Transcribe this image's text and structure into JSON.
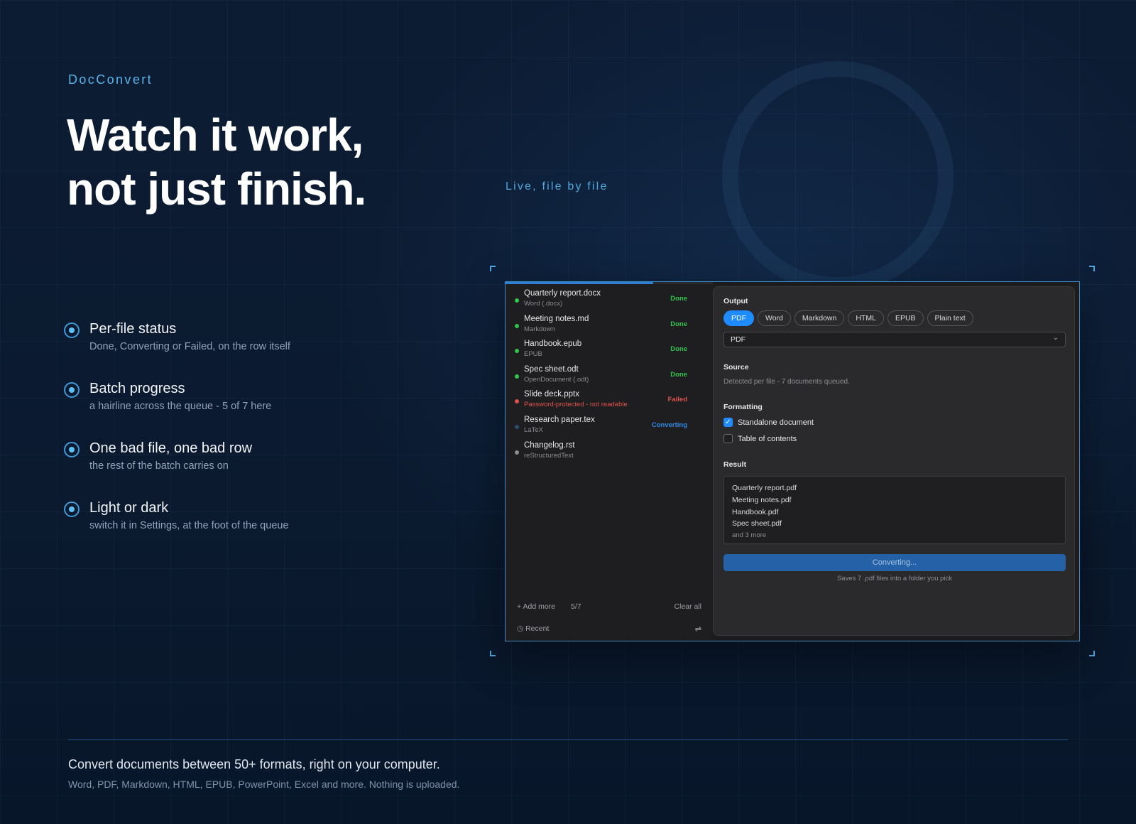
{
  "brand": "DocConvert",
  "headline": {
    "line1": "Watch it work,",
    "line2": "not just finish."
  },
  "kicker": "Live, file by file",
  "features": [
    {
      "title": "Per-file status",
      "desc": "Done, Converting or Failed, on the row itself"
    },
    {
      "title": "Batch progress",
      "desc": "a hairline across the queue - 5 of 7 here"
    },
    {
      "title": "One bad file, one bad row",
      "desc": "the rest of the batch carries on"
    },
    {
      "title": "Light or dark",
      "desc": "switch it in Settings, at the foot of the queue"
    }
  ],
  "queue": {
    "progress_fraction": 0.714,
    "items": [
      {
        "name": "Quarterly report.docx",
        "type": "Word (.docx)",
        "status": "Done",
        "state": "done"
      },
      {
        "name": "Meeting notes.md",
        "type": "Markdown",
        "status": "Done",
        "state": "done"
      },
      {
        "name": "Handbook.epub",
        "type": "EPUB",
        "status": "Done",
        "state": "done"
      },
      {
        "name": "Spec sheet.odt",
        "type": "OpenDocument (.odt)",
        "status": "Done",
        "state": "done"
      },
      {
        "name": "Slide deck.pptx",
        "type": "Password-protected - not readable",
        "status": "Failed",
        "state": "failed"
      },
      {
        "name": "Research paper.tex",
        "type": "LaTeX",
        "status": "Converting",
        "state": "converting"
      },
      {
        "name": "Changelog.rst",
        "type": "reStructuredText",
        "status": "",
        "state": "pending"
      }
    ],
    "add_more": "Add more",
    "count": "5/7",
    "clear_all": "Clear all",
    "recent": "Recent"
  },
  "panel": {
    "output_label": "Output",
    "formats": [
      "PDF",
      "Word",
      "Markdown",
      "HTML",
      "EPUB",
      "Plain text"
    ],
    "selected_format": "PDF",
    "select_value": "PDF",
    "source_label": "Source",
    "source_text": "Detected per file - 7 documents queued.",
    "formatting_label": "Formatting",
    "standalone_label": "Standalone document",
    "standalone_checked": true,
    "toc_label": "Table of contents",
    "toc_checked": false,
    "result_label": "Result",
    "result_files": [
      "Quarterly report.pdf",
      "Meeting notes.pdf",
      "Handbook.pdf",
      "Spec sheet.pdf"
    ],
    "result_more": "and 3 more",
    "convert_button": "Converting...",
    "saves_note": "Saves 7 .pdf files into a folder you pick"
  },
  "colors": {
    "done": "#30c54d",
    "failed": "#e0524d",
    "converting": "#2f8ae8",
    "pending": "#8b8b90",
    "accent": "#1e8cff"
  },
  "footer": {
    "tagline": "Convert documents between 50+ formats, right on your computer.",
    "sub": "Word, PDF, Markdown, HTML, EPUB, PowerPoint, Excel and more. Nothing is uploaded."
  }
}
